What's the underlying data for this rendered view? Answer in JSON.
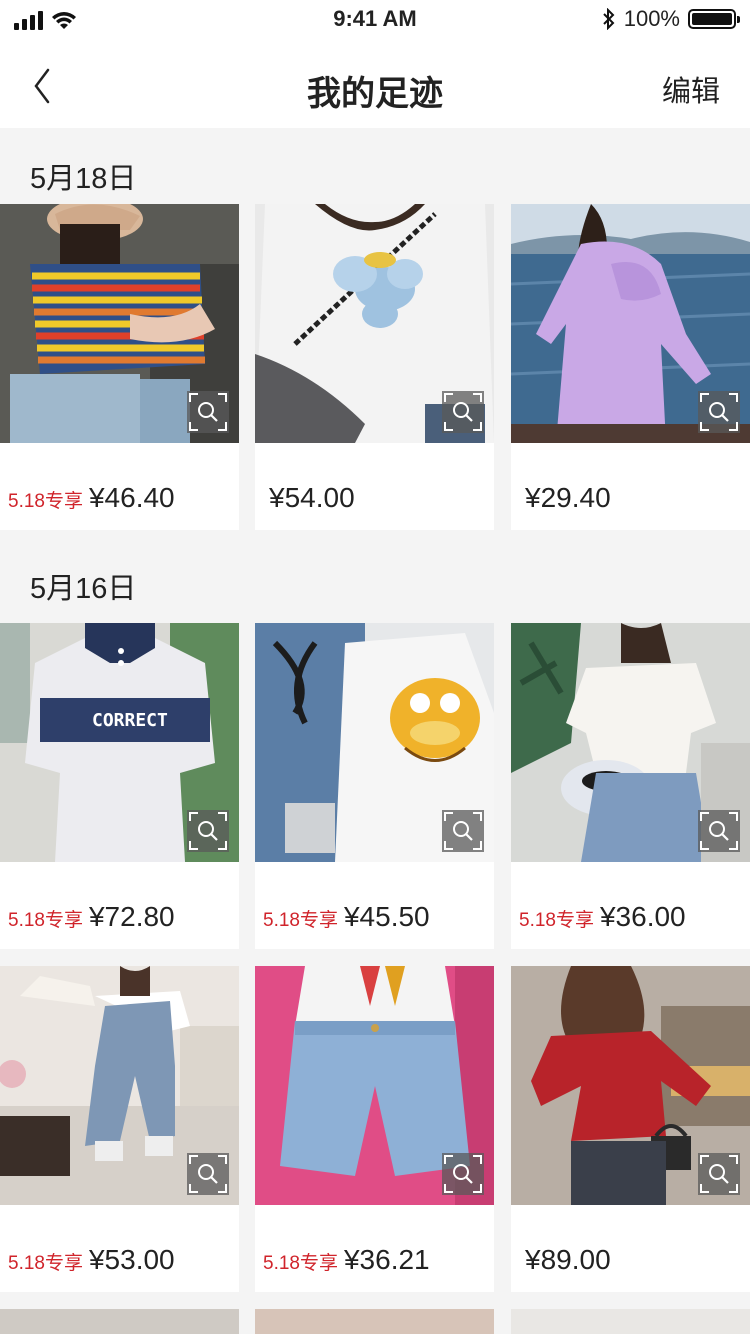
{
  "status_bar": {
    "time": "9:41 AM",
    "battery": "100%",
    "battery_level": 1.0,
    "icons": [
      "signal-icon",
      "wifi-icon",
      "bluetooth-icon",
      "battery-icon"
    ]
  },
  "nav": {
    "back_icon": "chevron-left-icon",
    "title": "我的足迹",
    "edit_label": "编辑"
  },
  "sections": [
    {
      "date": "5月18日",
      "items": [
        {
          "promo": "5.18专享",
          "price": "¥46.40",
          "image": "striped-tee-photo"
        },
        {
          "promo": "",
          "price": "¥54.00",
          "image": "elephant-tee-photo"
        },
        {
          "promo": "",
          "price": "¥29.40",
          "image": "lavender-coat-photo"
        }
      ]
    },
    {
      "date": "5月16日",
      "items": [
        {
          "promo": "5.18专享",
          "price": "¥72.80",
          "image": "polo-shirt-photo",
          "print_text": "CORRECT"
        },
        {
          "promo": "5.18专享",
          "price": "¥45.50",
          "image": "cartoon-cat-tee-photo"
        },
        {
          "promo": "5.18专享",
          "price": "¥36.00",
          "image": "white-blouse-photo"
        },
        {
          "promo": "5.18专享",
          "price": "¥53.00",
          "image": "denim-overalls-photo"
        },
        {
          "promo": "5.18专享",
          "price": "¥36.21",
          "image": "denim-shorts-photo"
        },
        {
          "promo": "",
          "price": "¥89.00",
          "image": "red-blouse-photo"
        }
      ]
    }
  ],
  "colors": {
    "promo": "#d0242b",
    "background": "#f4f4f4",
    "card": "#ffffff"
  }
}
